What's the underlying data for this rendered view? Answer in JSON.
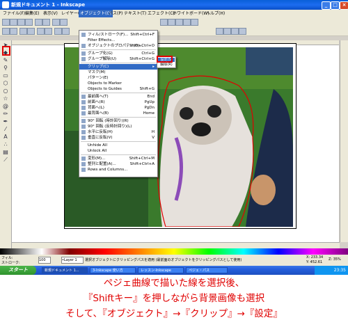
{
  "window": {
    "title": "新規ドキュメント 1 - Inkscape",
    "buttons": {
      "minimize": "_",
      "maximize": "□",
      "close": "×"
    }
  },
  "menubar": {
    "items": [
      "ファイル(F)",
      "編集(E)",
      "表示(V)",
      "レイヤー(L)",
      "オブジェクト(O)",
      "パス(P)",
      "テキスト(T)",
      "エフェクト(C)",
      "ホワイトボード(W)",
      "ヘルプ(H)"
    ],
    "active_index": 4
  },
  "object_menu": {
    "items": [
      {
        "label": "フィル/ストローク(F)...",
        "shortcut": "Shift+Ctrl+F",
        "icon": "fill-stroke-icon"
      },
      {
        "label": "Filter Effects...",
        "shortcut": "",
        "icon": ""
      },
      {
        "label": "オブジェクトのプロパティ(O)...",
        "shortcut": "Shift+Ctrl+O",
        "icon": "properties-icon"
      },
      {
        "sep": true
      },
      {
        "label": "グループ化(G)",
        "shortcut": "Ctrl+G",
        "icon": "group-icon"
      },
      {
        "label": "グループ解除(U)",
        "shortcut": "Shift+Ctrl+G",
        "icon": "ungroup-icon"
      },
      {
        "sep": true
      },
      {
        "label": "クリップ(C)",
        "shortcut": "▸",
        "icon": "",
        "highlight": true
      },
      {
        "label": "マスク(M)",
        "shortcut": "",
        "icon": ""
      },
      {
        "label": "パターン(E)",
        "shortcut": "",
        "icon": ""
      },
      {
        "label": "Objects to Marker",
        "shortcut": "",
        "icon": ""
      },
      {
        "label": "Objects to Guides",
        "shortcut": "Shift+G",
        "icon": ""
      },
      {
        "sep": true
      },
      {
        "label": "最前面へ(T)",
        "shortcut": "End",
        "icon": "raise-top-icon"
      },
      {
        "label": "前面へ(R)",
        "shortcut": "PgUp",
        "icon": "raise-icon"
      },
      {
        "label": "背面へ(L)",
        "shortcut": "PgDn",
        "icon": "lower-icon"
      },
      {
        "label": "最背面へ(B)",
        "shortcut": "Home",
        "icon": "lower-bottom-icon"
      },
      {
        "sep": true
      },
      {
        "label": "90° 回転 (時計回り)(R)",
        "shortcut": "",
        "icon": "rotate-cw-icon"
      },
      {
        "label": "90° 回転 (反時計回り)(L)",
        "shortcut": "",
        "icon": "rotate-ccw-icon"
      },
      {
        "label": "水平に反転(H)",
        "shortcut": "H",
        "icon": "flip-h-icon"
      },
      {
        "label": "垂直に反転(V)",
        "shortcut": "V",
        "icon": "flip-v-icon"
      },
      {
        "sep": true
      },
      {
        "label": "Unhide All",
        "shortcut": "",
        "icon": ""
      },
      {
        "label": "Unlock All",
        "shortcut": "",
        "icon": ""
      },
      {
        "sep": true
      },
      {
        "label": "変形(M)...",
        "shortcut": "Shift+Ctrl+M",
        "icon": "transform-icon"
      },
      {
        "label": "整列と配置(A)...",
        "shortcut": "Shift+Ctrl+A",
        "icon": "align-icon"
      },
      {
        "label": "Rows and Columns...",
        "shortcut": "",
        "icon": "grid-arrange-icon"
      }
    ]
  },
  "clip_submenu": {
    "items": [
      "設定(S)",
      "解除(R)"
    ],
    "highlight_index": 0
  },
  "statusbar": {
    "fill_label": "フィル:",
    "stroke_label": "ストローク:",
    "opacity": "100",
    "layer": "•Layer 1",
    "message": "選択オブジェクトにクリッピングパスを適用 (最前面のオブジェクトをクリッピングパスとして使用)",
    "coords_x": "X: 233.34",
    "coords_y": "Y: 452.61",
    "zoom": "Z: 35%"
  },
  "taskbar": {
    "start_label": "スタート",
    "tasks": [
      "新規ドキュメント 1...",
      "3-Inkscape 使い方",
      "レッスン-Inkscape",
      "ペジェ・パス"
    ],
    "clock": "23:35"
  },
  "caption": {
    "line1": "ペジェ曲線で描いた線を選択後、",
    "line2": "『Shiftキー』を押しながら背景画像も選択",
    "line3": "そして、『オブジェクト』→『クリップ』→『設定』"
  },
  "colors": {
    "highlight": "#316ac5",
    "annotation_red": "#e00000",
    "titlebar": "#0a5fd8"
  }
}
